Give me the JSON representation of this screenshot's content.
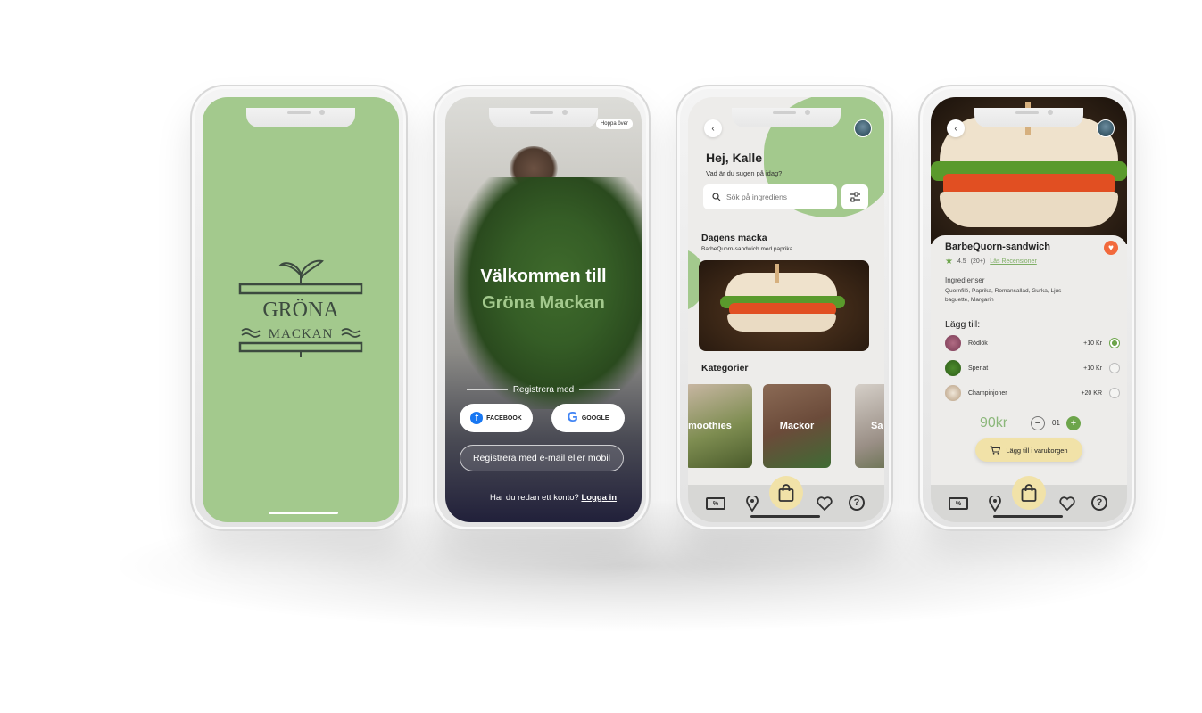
{
  "splash": {
    "logo_line1": "GRÖNA",
    "logo_line2": "MACKAN"
  },
  "onboarding": {
    "skip_label": "Hoppa över",
    "welcome_line1": "Välkommen till",
    "welcome_line2": "Gröna Mackan",
    "register_with": "Registrera med",
    "facebook_label": "FACEBOOK",
    "google_label": "GOOGLE",
    "email_register": "Registrera med e-mail eller mobil",
    "have_account": "Har du redan ett konto?",
    "login_link": "Logga in"
  },
  "home": {
    "greeting": "Hej, Kalle",
    "subtitle": "Vad är du sugen på idag?",
    "search_placeholder": "Sök på ingrediens",
    "daily_title": "Dagens macka",
    "daily_subtitle": "BarbeQuorn-sandwich med paprika",
    "categories_title": "Kategorier",
    "categories": [
      "moothies",
      "Mackor",
      "Sa"
    ]
  },
  "detail": {
    "title": "BarbeQuorn-sandwich",
    "rating": "4.5",
    "rating_count": "(20+)",
    "reviews_link": "Läs Recensioner",
    "ingredients_title": "Ingredienser",
    "ingredients_text": "Quornfilé, Paprika, Romansallad, Gurka, Ljus baguette, Margarin",
    "add_title": "Lägg till:",
    "addons": [
      {
        "name": "Rödlök",
        "price": "+10 Kr",
        "selected": true
      },
      {
        "name": "Spenat",
        "price": "+10 Kr",
        "selected": false
      },
      {
        "name": "Champinjoner",
        "price": "+20 KR",
        "selected": false
      }
    ],
    "price": "90kr",
    "quantity": "01",
    "add_to_cart": "Lägg till i varukorgen"
  },
  "navbar": {
    "coupon_icon_text": "%"
  },
  "colors": {
    "brand_green": "#a3c98d",
    "accent_green": "#6da54b",
    "cart_yellow": "#f1e2a8",
    "favorite_orange": "#f2693c"
  },
  "icons": [
    "back-icon",
    "search-icon",
    "filter-icon",
    "coupon-icon",
    "location-pin-icon",
    "shopping-bag-icon",
    "heart-icon",
    "help-icon",
    "star-icon",
    "cart-icon",
    "facebook-icon",
    "google-icon"
  ]
}
